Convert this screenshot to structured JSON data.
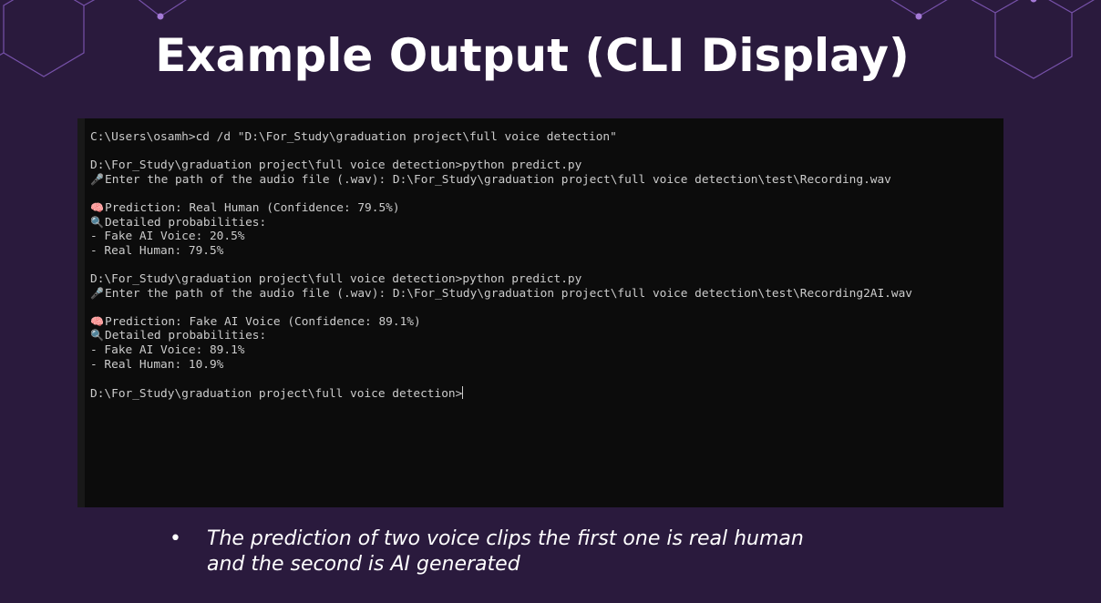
{
  "slide": {
    "title": "Example Output (CLI Display)",
    "caption_line1": "The prediction of two voice clips the first one is real human",
    "caption_line2": "and the second is AI generated",
    "bullet": "•"
  },
  "colors": {
    "background": "#2a1a3d",
    "hex_lines": "#8a5fc4",
    "terminal_bg": "#0c0c0c",
    "terminal_text": "#cccccc"
  },
  "terminal": {
    "lines": [
      {
        "icon": "",
        "text": "C:\\Users\\osamh>cd /d \"D:\\For_Study\\graduation project\\full voice detection\""
      },
      {
        "icon": "",
        "text": ""
      },
      {
        "icon": "",
        "text": "D:\\For_Study\\graduation project\\full voice detection>python predict.py"
      },
      {
        "icon": "🎤",
        "text": "Enter the path of the audio file (.wav): D:\\For_Study\\graduation project\\full voice detection\\test\\Recording.wav"
      },
      {
        "icon": "",
        "text": ""
      },
      {
        "icon": "🧠",
        "text": "Prediction: Real Human (Confidence: 79.5%)"
      },
      {
        "icon": "🔍",
        "text": "Detailed probabilities:"
      },
      {
        "icon": "",
        "text": "- Fake AI Voice: 20.5%"
      },
      {
        "icon": "",
        "text": "- Real Human: 79.5%"
      },
      {
        "icon": "",
        "text": ""
      },
      {
        "icon": "",
        "text": "D:\\For_Study\\graduation project\\full voice detection>python predict.py"
      },
      {
        "icon": "🎤",
        "text": "Enter the path of the audio file (.wav): D:\\For_Study\\graduation project\\full voice detection\\test\\Recording2AI.wav"
      },
      {
        "icon": "",
        "text": ""
      },
      {
        "icon": "🧠",
        "text": "Prediction: Fake AI Voice (Confidence: 89.1%)"
      },
      {
        "icon": "🔍",
        "text": "Detailed probabilities:"
      },
      {
        "icon": "",
        "text": "- Fake AI Voice: 89.1%"
      },
      {
        "icon": "",
        "text": "- Real Human: 10.9%"
      },
      {
        "icon": "",
        "text": ""
      },
      {
        "icon": "",
        "text": "D:\\For_Study\\graduation project\\full voice detection>",
        "cursor": true
      }
    ]
  }
}
